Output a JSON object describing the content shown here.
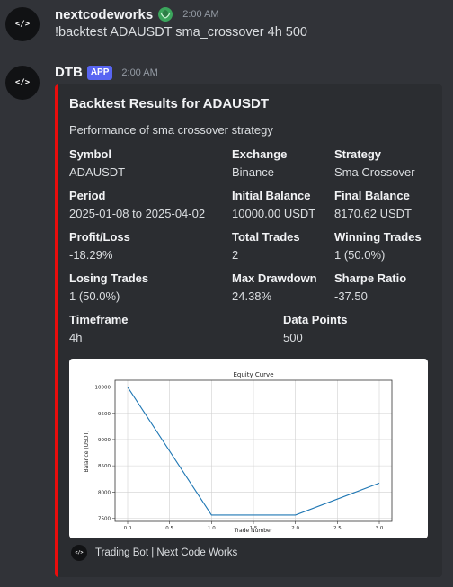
{
  "messages": [
    {
      "avatar_text": "</>",
      "username": "nextcodeworks",
      "badge_icon": "leaf-badge-icon",
      "timestamp": "2:00 AM",
      "content": "!backtest ADAUSDT sma_crossover 4h 500"
    },
    {
      "avatar_text": "</>",
      "username": "DTB",
      "app_badge": "APP",
      "timestamp": "2:00 AM"
    }
  ],
  "embed": {
    "color": "#ea0d0d",
    "title": "Backtest Results for ADAUSDT",
    "description": "Performance of sma crossover strategy",
    "fields": [
      {
        "name": "Symbol",
        "value": "ADAUSDT"
      },
      {
        "name": "Exchange",
        "value": "Binance"
      },
      {
        "name": "Strategy",
        "value": "Sma Crossover"
      },
      {
        "name": "Period",
        "value": "2025-01-08 to 2025-04-02"
      },
      {
        "name": "Initial Balance",
        "value": "10000.00 USDT"
      },
      {
        "name": "Final Balance",
        "value": "8170.62 USDT"
      },
      {
        "name": "Profit/Loss",
        "value": "-18.29%"
      },
      {
        "name": "Total Trades",
        "value": "2"
      },
      {
        "name": "Winning Trades",
        "value": "1 (50.0%)"
      },
      {
        "name": "Losing Trades",
        "value": "1 (50.0%)"
      },
      {
        "name": "Max Drawdown",
        "value": "24.38%"
      },
      {
        "name": "Sharpe Ratio",
        "value": "-37.50"
      },
      {
        "name": "Timeframe",
        "value": "4h"
      },
      {
        "name": "Data Points",
        "value": "500"
      }
    ],
    "footer": {
      "icon_text": "</>",
      "text": "Trading Bot | Next Code Works"
    }
  },
  "chart_data": {
    "type": "line",
    "title": "Equity Curve",
    "xlabel": "Trade Number",
    "ylabel": "Balance (USDT)",
    "x": [
      0,
      1,
      2,
      3
    ],
    "y": [
      10000.0,
      7562.0,
      7562.0,
      8170.62
    ],
    "xlim": [
      -0.15,
      3.15
    ],
    "ylim": [
      7440,
      10130
    ],
    "xticks": [
      0.0,
      0.5,
      1.0,
      1.5,
      2.0,
      2.5,
      3.0
    ],
    "xtick_labels": [
      "0.0",
      "0.5",
      "1.0",
      "1.5",
      "2.0",
      "2.5",
      "3.0"
    ],
    "yticks": [
      7500,
      8000,
      8500,
      9000,
      9500,
      10000
    ],
    "ytick_labels": [
      "7500",
      "8000",
      "8500",
      "9000",
      "9500",
      "10000"
    ],
    "grid": true,
    "line_color": "#1f77b4"
  }
}
